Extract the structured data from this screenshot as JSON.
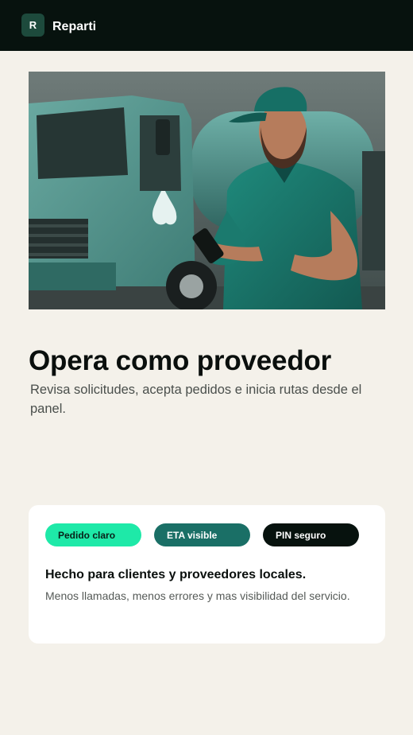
{
  "header": {
    "logo_letter": "R",
    "brand_name": "Reparti"
  },
  "hero": {
    "image_alt": "Repartidor junto a camión cisterna revisando su teléfono"
  },
  "main": {
    "title": "Opera como proveedor",
    "subtitle": "Revisa solicitudes, acepta pedidos e inicia rutas desde el panel."
  },
  "feature_card": {
    "chips": [
      {
        "label": "Pedido claro"
      },
      {
        "label": "ETA visible"
      },
      {
        "label": "PIN seguro"
      }
    ],
    "title": "Hecho para clientes y proveedores locales.",
    "description": "Menos llamadas, menos errores y mas visibilidad del servicio."
  },
  "colors": {
    "topbar": "#07120e",
    "background": "#f4f1ea",
    "chip_accent": "#1ee9a8",
    "chip_teal": "#1a6f66",
    "chip_dark": "#07120e"
  }
}
